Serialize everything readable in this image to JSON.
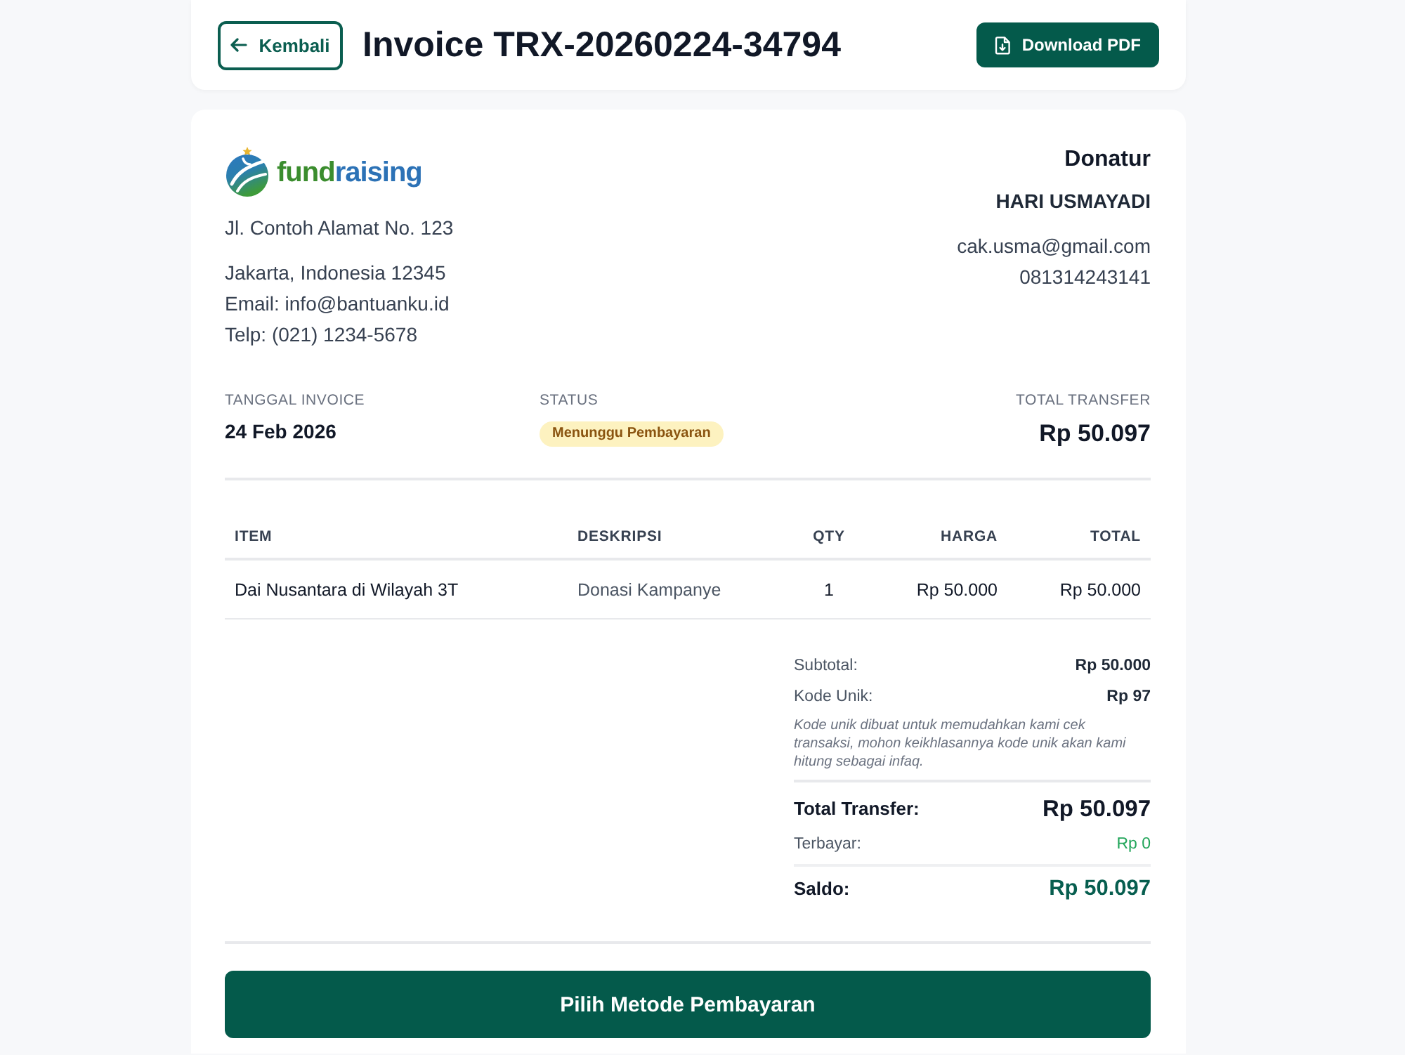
{
  "header": {
    "back_button": "Kembali",
    "title": "Invoice TRX-20260224-34794",
    "download_button": "Download PDF"
  },
  "company": {
    "logo": [
      {
        "text": "fund",
        "color": "#3b8d2e"
      },
      {
        "text": "raising",
        "color": "#2c72b6"
      }
    ],
    "address": "Jl. Contoh Alamat No. 123",
    "contact_lines": [
      "Jakarta, Indonesia 12345",
      "Email: info@bantuanku.id",
      "Telp: (021) 1234-5678"
    ]
  },
  "donor": {
    "heading": "Donatur",
    "name": "HARI USMAYADI",
    "email": "cak.usma@gmail.com",
    "phone": "081314243141"
  },
  "meta": [
    {
      "kind": "text",
      "label": "TANGGAL INVOICE",
      "value": "24 Feb 2026"
    },
    {
      "kind": "badge",
      "label": "STATUS",
      "value": "Menunggu Pembayaran"
    },
    {
      "kind": "amount",
      "label": "TOTAL TRANSFER",
      "value": "Rp 50.097"
    }
  ],
  "table": {
    "columns": [
      "ITEM",
      "DESKRIPSI",
      "QTY",
      "HARGA",
      "TOTAL"
    ],
    "rows": [
      [
        "Dai Nusantara di Wilayah 3T",
        "Donasi Kampanye",
        "1",
        "Rp 50.000",
        "Rp 50.000"
      ]
    ]
  },
  "summary": [
    {
      "kind": "line",
      "label": "Subtotal:",
      "value": "Rp 50.000"
    },
    {
      "kind": "line",
      "label": "Kode Unik:",
      "value": "Rp 97"
    },
    {
      "kind": "note",
      "text": "Kode unik dibuat untuk memudahkan kami cek transaksi, mohon keikhlasannya kode unik akan kami hitung sebagai infaq."
    },
    {
      "kind": "total",
      "label": "Total Transfer:",
      "value": "Rp 50.097"
    },
    {
      "kind": "paid",
      "label": "Terbayar:",
      "value": "Rp 0"
    },
    {
      "kind": "balance",
      "label": "Saldo:",
      "value": "Rp 50.097"
    }
  ],
  "pay_button": "Pilih Metode Pembayaran"
}
